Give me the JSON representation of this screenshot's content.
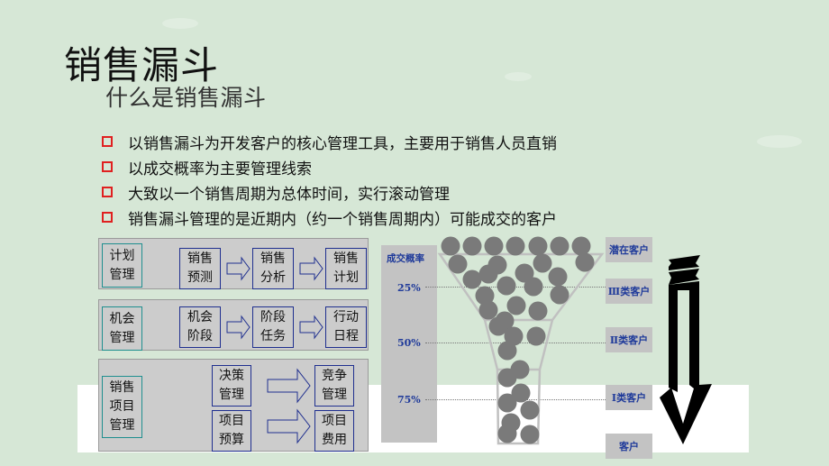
{
  "title": "销售漏斗",
  "subtitle": "什么是销售漏斗",
  "bullets": [
    "以销售漏斗为开发客户的核心管理工具，主要用于销售人员直销",
    "以成交概率为主要管理线索",
    "大致以一个销售周期为总体时间，实行滚动管理",
    "销售漏斗管理的是近期内（约一个销售周期内）可能成交的客户"
  ],
  "colors": {
    "background": "#d6e7d6",
    "bullet": "#e02020",
    "panel": "#cccccc",
    "teal_border": "#1f8f8f",
    "navy_border": "#1f2f8f",
    "label_blue": "#1f3a9a",
    "ball": "#7a7a7a",
    "funnel_outline": "#c0c0c0"
  },
  "panels": {
    "plan": {
      "head": "计划\n管理",
      "steps": [
        "销售\n预测",
        "销售\n分析",
        "销售\n计划"
      ]
    },
    "opportunity": {
      "head": "机会\n管理",
      "steps": [
        "机会\n阶段",
        "阶段\n任务",
        "行动\n日程"
      ]
    },
    "project": {
      "head": "销售\n项目\n管理",
      "flows": [
        {
          "from": "决策\n管理",
          "to": "竞争\n管理"
        },
        {
          "from": "项目\n预算",
          "to": "项目\n费用"
        }
      ]
    }
  },
  "funnel": {
    "probability_header": "成交概率",
    "probability_levels": [
      "25%",
      "50%",
      "75%"
    ],
    "customer_tiers": [
      "潜在客户",
      "Ⅲ类客户",
      "Ⅱ类客户",
      "Ⅰ类客户",
      "客户"
    ]
  }
}
